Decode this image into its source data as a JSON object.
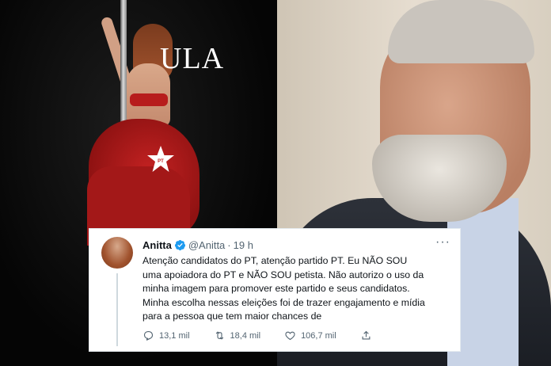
{
  "collage": {
    "overlay_text": "ULA",
    "star_label": "PT",
    "colors": {
      "brand_red": "#c42222",
      "twitter_blue": "#1d9bf0"
    }
  },
  "tweet": {
    "display_name": "Anitta",
    "handle": "@Anitta",
    "separator": "·",
    "time": "19 h",
    "more_label": "···",
    "lines": [
      "Atenção candidatos do PT, atenção partido PT. Eu NÃO SOU",
      "uma apoiadora do PT e NÃO SOU petista. Não autorizo o uso da",
      "minha imagem para promover este partido e seus candidatos.",
      "Minha escolha nessas eleições foi de trazer engajamento e mídia",
      "para a pessoa que tem maior chances de"
    ],
    "actions": {
      "reply_count": "13,1 mil",
      "retweet_count": "18,4 mil",
      "like_count": "106,7 mil"
    }
  }
}
